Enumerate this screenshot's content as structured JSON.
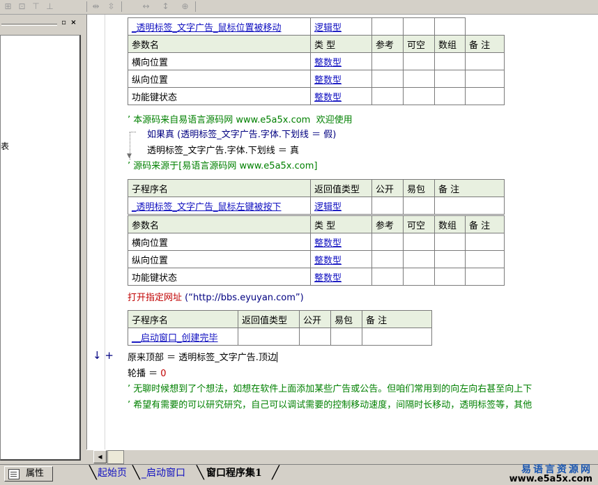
{
  "toolbar": {
    "icons": [
      "align-left-icon",
      "align-center-icon",
      "align-top-icon",
      "align-middle-icon",
      "same-width-icon",
      "same-height-icon",
      "h-space-icon",
      "v-space-icon",
      "center-icon"
    ]
  },
  "left_pane": {
    "fragment_text": "表"
  },
  "sub1": {
    "name": "_透明标签_文字广告_鼠标位置被移动",
    "return_type": "逻辑型",
    "param_headers": [
      "参数名",
      "类 型",
      "参考",
      "可空",
      "数组",
      "备 注"
    ],
    "params": [
      {
        "name": "横向位置",
        "type": "整数型"
      },
      {
        "name": "纵向位置",
        "type": "整数型"
      },
      {
        "name": "功能键状态",
        "type": "整数型"
      }
    ]
  },
  "code1": {
    "comment1": "’ 本源码来自易语言源码网 www.e5a5x.com  欢迎使用",
    "if_line": "如果真 (透明标签_文字广告.字体.下划线 ＝ 假)",
    "assign_line": "透明标签_文字广告.字体.下划线 ＝ 真",
    "comment2": "’ 源码来源于[易语言源码网 www.e5a5x.com]"
  },
  "sub2": {
    "headers": [
      "子程序名",
      "返回值类型",
      "公开",
      "易包",
      "备 注"
    ],
    "name": "_透明标签_文字广告_鼠标左键被按下",
    "return_type": "逻辑型",
    "param_headers": [
      "参数名",
      "类 型",
      "参考",
      "可空",
      "数组",
      "备 注"
    ],
    "params": [
      {
        "name": "横向位置",
        "type": "整数型"
      },
      {
        "name": "纵向位置",
        "type": "整数型"
      },
      {
        "name": "功能键状态",
        "type": "整数型"
      }
    ]
  },
  "code2": {
    "open_url_cmd": "打开指定网址",
    "open_url_args": "(“http://bbs.eyuyan.com”)"
  },
  "sub3": {
    "headers": [
      "子程序名",
      "返回值类型",
      "公开",
      "易包",
      "备 注"
    ],
    "name": "__启动窗口_创建完毕"
  },
  "code3": {
    "markers": "↓ +",
    "line1": "原来顶部 ＝ 透明标签_文字广告.顶边",
    "line2_var": "轮播 ＝ ",
    "line2_val": "0",
    "comment3": "’ 无聊时候想到了个想法，如想在软件上面添加某些广告或公告。但咱们常用到的向左向右甚至向上下",
    "comment4": "’ 希望有需要的可以研究研究，自己可以调试需要的控制移动速度，间隔时长移动，透明标签等，其他"
  },
  "bottom": {
    "properties_label": "属性",
    "tabs": [
      "起始页",
      "_启动窗口",
      "窗口程序集1"
    ],
    "watermark_cn": "易语言资源网",
    "watermark_url": "www.e5a5x.com"
  }
}
